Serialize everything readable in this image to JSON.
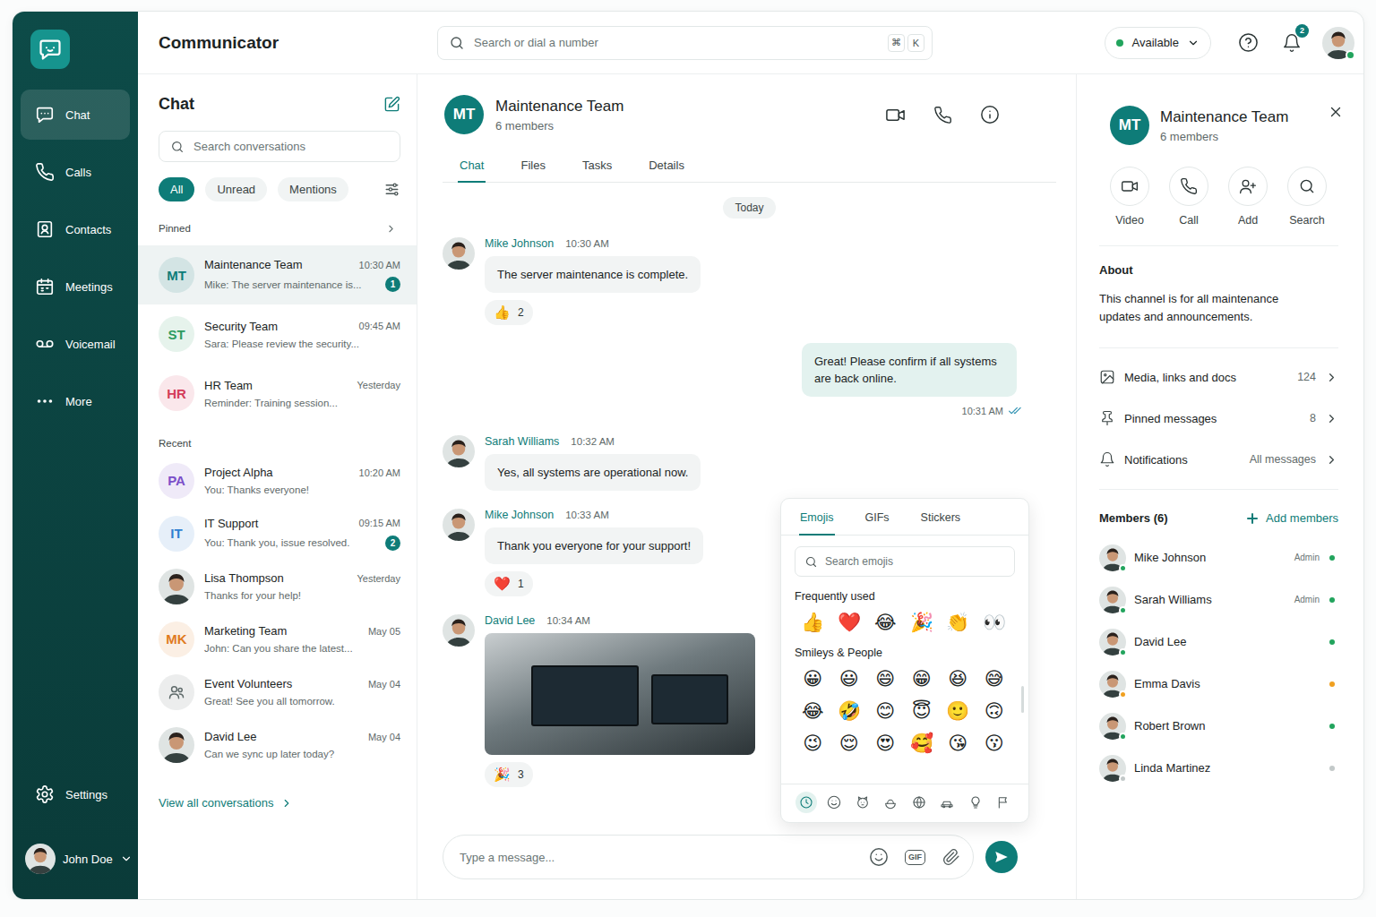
{
  "app": {
    "title": "Communicator"
  },
  "nav": {
    "items": [
      {
        "label": "Chat",
        "selected": true
      },
      {
        "label": "Calls",
        "selected": false
      },
      {
        "label": "Contacts",
        "selected": false
      },
      {
        "label": "Meetings",
        "selected": false
      },
      {
        "label": "Voicemail",
        "selected": false
      },
      {
        "label": "More",
        "selected": false
      }
    ],
    "settings": "Settings",
    "user": {
      "name": "John Doe"
    }
  },
  "topbar": {
    "search_placeholder": "Search or dial a number",
    "shortcut": [
      "⌘",
      "K"
    ],
    "status": {
      "label": "Available",
      "color": "#22a45d"
    },
    "notifications": "2"
  },
  "chat_list": {
    "title": "Chat",
    "search_placeholder": "Search conversations",
    "filters": [
      {
        "label": "All",
        "selected": true
      },
      {
        "label": "Unread",
        "selected": false
      },
      {
        "label": "Mentions",
        "selected": false
      }
    ],
    "sections": [
      {
        "label": "Pinned",
        "more": true,
        "items": [
          {
            "kind": "initials",
            "initials": "MT",
            "color": "#0e7c78",
            "name": "Maintenance Team",
            "time": "10:30 AM",
            "preview": "Mike: The server maintenance is...",
            "unread": "1",
            "selected": true
          },
          {
            "kind": "initials",
            "initials": "ST",
            "color": "#2e9b5f",
            "name": "Security Team",
            "time": "09:45 AM",
            "preview": "Sara: Please review the security...",
            "unread": "",
            "selected": false
          },
          {
            "kind": "initials",
            "initials": "HR",
            "color": "#d43c5a",
            "name": "HR Team",
            "time": "Yesterday",
            "preview": "Reminder: Training session...",
            "unread": "",
            "selected": false
          }
        ]
      },
      {
        "label": "Recent",
        "more": false,
        "items": [
          {
            "kind": "initials",
            "initials": "PA",
            "color": "#7b4fc9",
            "name": "Project Alpha",
            "time": "10:20 AM",
            "preview": "You: Thanks everyone!",
            "unread": "",
            "selected": false
          },
          {
            "kind": "initials",
            "initials": "IT",
            "color": "#2f7fd1",
            "name": "IT Support",
            "time": "09:15 AM",
            "preview": "You: Thank you, issue resolved.",
            "unread": "2",
            "selected": false
          },
          {
            "kind": "photo",
            "name": "Lisa Thompson",
            "time": "Yesterday",
            "preview": "Thanks for your help!",
            "unread": "",
            "selected": false
          },
          {
            "kind": "initials",
            "initials": "MK",
            "color": "#e07b1f",
            "name": "Marketing Team",
            "time": "May 05",
            "preview": "John: Can you share the latest...",
            "unread": "",
            "selected": false
          },
          {
            "kind": "group",
            "color": "#5f6b6b",
            "name": "Event Volunteers",
            "time": "May 04",
            "preview": "Great! See you all tomorrow.",
            "unread": "",
            "selected": false
          },
          {
            "kind": "photo",
            "name": "David Lee",
            "time": "May 04",
            "preview": "Can we sync up later today?",
            "unread": "",
            "selected": false
          }
        ]
      }
    ],
    "view_all": "View all conversations"
  },
  "conversation": {
    "initials": "MT",
    "title": "Maintenance Team",
    "members": "6 members",
    "tabs": [
      {
        "label": "Chat",
        "selected": true
      },
      {
        "label": "Files",
        "selected": false
      },
      {
        "label": "Tasks",
        "selected": false
      },
      {
        "label": "Details",
        "selected": false
      }
    ],
    "date": "Today",
    "messages": [
      {
        "kind": "incoming",
        "author": "Mike Johnson",
        "time": "10:30 AM",
        "text": "The server maintenance is complete.",
        "reaction": {
          "emoji": "👍",
          "count": "2"
        }
      },
      {
        "kind": "outgoing",
        "time": "10:31 AM",
        "text": "Great! Please confirm if all systems are back online.",
        "read": true
      },
      {
        "kind": "incoming",
        "author": "Sarah Williams",
        "time": "10:32 AM",
        "text": "Yes, all systems are operational now."
      },
      {
        "kind": "incoming",
        "author": "Mike Johnson",
        "time": "10:33 AM",
        "text": "Thank you everyone for your support!",
        "reaction": {
          "emoji": "❤️",
          "count": "1"
        }
      },
      {
        "kind": "image",
        "author": "David Lee",
        "time": "10:34 AM",
        "reaction": {
          "emoji": "🎉",
          "count": "3"
        }
      }
    ],
    "composer": {
      "placeholder": "Type a message...",
      "gif": "GIF"
    }
  },
  "emoji_picker": {
    "tabs": [
      {
        "label": "Emojis",
        "selected": true
      },
      {
        "label": "GIFs",
        "selected": false
      },
      {
        "label": "Stickers",
        "selected": false
      }
    ],
    "search_placeholder": "Search emojis",
    "sections": [
      {
        "label": "Frequently used",
        "emojis": [
          "👍",
          "❤️",
          "😂",
          "🎉",
          "👏",
          "👀"
        ]
      },
      {
        "label": "Smileys & People",
        "emojis": [
          "😀",
          "😃",
          "😄",
          "😁",
          "😆",
          "😅",
          "😂",
          "🤣",
          "😊",
          "😇",
          "🙂",
          "🙃",
          "😉",
          "😌",
          "😍",
          "🥰",
          "😘",
          "😗"
        ]
      }
    ],
    "categories": [
      {
        "selected": true
      },
      {
        "selected": false
      },
      {
        "selected": false
      },
      {
        "selected": false
      },
      {
        "selected": false
      },
      {
        "selected": false
      },
      {
        "selected": false
      },
      {
        "selected": false
      }
    ]
  },
  "details": {
    "initials": "MT",
    "title": "Maintenance Team",
    "members": "6 members",
    "actions": [
      "Video",
      "Call",
      "Add",
      "Search"
    ],
    "about": {
      "title": "About",
      "text": "This channel is for all maintenance updates and announcements."
    },
    "rows": [
      {
        "label": "Media, links and docs",
        "value": "124"
      },
      {
        "label": "Pinned messages",
        "value": "8"
      },
      {
        "label": "Notifications",
        "value": "All messages"
      }
    ],
    "members_title": "Members (6)",
    "add_members": "Add members",
    "member_list": [
      {
        "name": "Mike Johnson",
        "role": "Admin",
        "color": "#22a45d"
      },
      {
        "name": "Sarah Williams",
        "role": "Admin",
        "color": "#22a45d"
      },
      {
        "name": "David Lee",
        "role": "",
        "color": "#22a45d"
      },
      {
        "name": "Emma Davis",
        "role": "",
        "color": "#f0a020"
      },
      {
        "name": "Robert Brown",
        "role": "",
        "color": "#22a45d"
      },
      {
        "name": "Linda Martinez",
        "role": "",
        "color": "#c3c9c9"
      }
    ]
  }
}
